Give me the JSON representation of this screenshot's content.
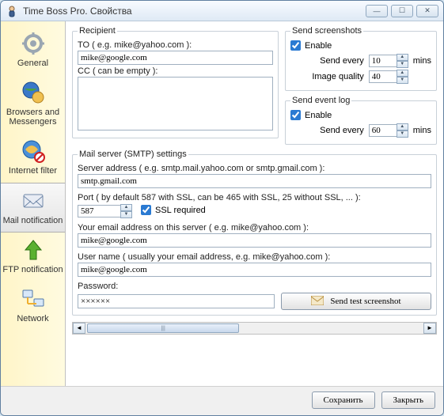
{
  "title": "Time Boss Pro. Свойства",
  "sidebar": {
    "items": [
      {
        "label": "General"
      },
      {
        "label": "Browsers and Messengers"
      },
      {
        "label": "Internet filter"
      },
      {
        "label": "Mail notification"
      },
      {
        "label": "FTP notification"
      },
      {
        "label": "Network"
      }
    ]
  },
  "recipient": {
    "legend": "Recipient",
    "to_label": "TO ( e.g. mike@yahoo.com ):",
    "to_value": "mike@google.com",
    "cc_label": "CC ( can be empty ):",
    "cc_value": ""
  },
  "screenshots": {
    "legend": "Send screenshots",
    "enable_label": "Enable",
    "enable_checked": true,
    "send_every_label": "Send every",
    "send_every_value": "10",
    "mins_label": "mins",
    "quality_label": "Image quality",
    "quality_value": "40"
  },
  "eventlog": {
    "legend": "Send event log",
    "enable_label": "Enable",
    "enable_checked": true,
    "send_every_label": "Send every",
    "send_every_value": "60",
    "mins_label": "mins"
  },
  "smtp": {
    "legend": "Mail server (SMTP) settings",
    "server_label": "Server address   ( e.g. smtp.mail.yahoo.com or smtp.gmail.com ):",
    "server_value": "smtp.gmail.com",
    "port_label": "Port   ( by default 587 with SSL, can be 465 with SSL, 25 without SSL, ... ):",
    "port_value": "587",
    "ssl_label": "SSL required",
    "ssl_checked": true,
    "email_label": "Your email address on this server ( e.g. mike@yahoo.com ):",
    "email_value": "mike@google.com",
    "user_label": "User name  ( usually your email address, e.g. mike@yahoo.com ):",
    "user_value": "mike@google.com",
    "pass_label": "Password:",
    "pass_value": "××××××",
    "test_label": "Send test screenshot"
  },
  "footer": {
    "save": "Сохранить",
    "close": "Закрыть"
  }
}
